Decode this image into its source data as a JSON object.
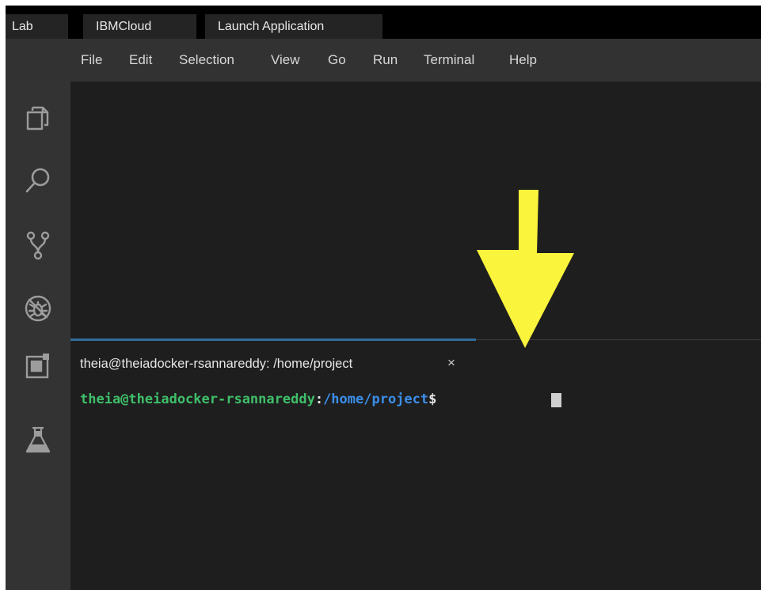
{
  "browser_tabs": [
    {
      "label": "Lab"
    },
    {
      "label": "IBMCloud"
    },
    {
      "label": "Launch Application"
    }
  ],
  "menu": [
    "File",
    "Edit",
    "Selection",
    "View",
    "Go",
    "Run",
    "Terminal",
    "Help"
  ],
  "activity_bar": [
    {
      "icon": "explorer-icon"
    },
    {
      "icon": "search-icon"
    },
    {
      "icon": "source-control-icon"
    },
    {
      "icon": "debug-icon"
    },
    {
      "icon": "extensions-icon"
    },
    {
      "icon": "lab-flask-icon"
    }
  ],
  "terminal": {
    "tab_title": "theia@theiadocker-rsannareddy: /home/project",
    "close_glyph": "×",
    "prompt_user": "theia@theiadocker-rsannareddy",
    "prompt_sep": ":",
    "prompt_path": "/home/project",
    "prompt_symbol": "$"
  },
  "colors": {
    "annotation_arrow": "#fbf43c",
    "prompt_user": "#3fbf6a",
    "prompt_path": "#3b8eea",
    "panel_accent": "#2f6d9a"
  }
}
